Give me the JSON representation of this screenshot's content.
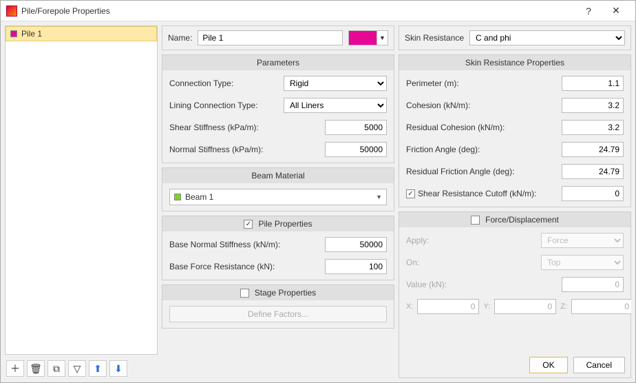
{
  "window": {
    "title": "Pile/Forepole Properties"
  },
  "list": {
    "items": [
      {
        "name": "Pile 1",
        "color": "#e60894"
      }
    ]
  },
  "toolbar": {
    "add": "＋",
    "delete": "🗑",
    "duplicate": "⧉",
    "filter": "▽",
    "up": "⬆",
    "down": "⬇"
  },
  "name_bar": {
    "label": "Name:",
    "value": "Pile 1",
    "color": "#e60894"
  },
  "parameters": {
    "title": "Parameters",
    "connection_type_label": "Connection Type:",
    "connection_type": "Rigid",
    "lining_connection_label": "Lining Connection Type:",
    "lining_connection": "All Liners",
    "shear_stiffness_label": "Shear Stiffness (kPa/m):",
    "shear_stiffness": "5000",
    "normal_stiffness_label": "Normal Stiffness (kPa/m):",
    "normal_stiffness": "50000"
  },
  "beam": {
    "title": "Beam Material",
    "value": "Beam 1",
    "color": "#7ed321"
  },
  "pile_props": {
    "title": "Pile Properties",
    "enabled": true,
    "base_normal_label": "Base Normal Stiffness (kN/m):",
    "base_normal": "50000",
    "base_force_label": "Base Force Resistance (kN):",
    "base_force": "100"
  },
  "stage": {
    "title": "Stage Properties",
    "enabled": false,
    "button": "Define Factors..."
  },
  "skin_bar": {
    "label": "Skin Resistance",
    "value": "C and phi"
  },
  "skin_props": {
    "title": "Skin Resistance Properties",
    "perimeter_label": "Perimeter (m):",
    "perimeter": "1.1",
    "cohesion_label": "Cohesion (kN/m):",
    "cohesion": "3.2",
    "res_cohesion_label": "Residual Cohesion (kN/m):",
    "res_cohesion": "3.2",
    "friction_label": "Friction Angle (deg):",
    "friction": "24.79",
    "res_friction_label": "Residual Friction Angle (deg):",
    "res_friction": "24.79",
    "cutoff_label": "Shear Resistance Cutoff (kN/m):",
    "cutoff_enabled": true,
    "cutoff": "0"
  },
  "force_disp": {
    "title": "Force/Displacement",
    "enabled": false,
    "apply_label": "Apply:",
    "apply": "Force",
    "on_label": "On:",
    "on": "Top",
    "value_label": "Value (kN):",
    "value": "0",
    "x_label": "X:",
    "x": "0",
    "y_label": "Y:",
    "y": "0",
    "z_label": "Z:",
    "z": "0"
  },
  "buttons": {
    "ok": "OK",
    "cancel": "Cancel"
  }
}
